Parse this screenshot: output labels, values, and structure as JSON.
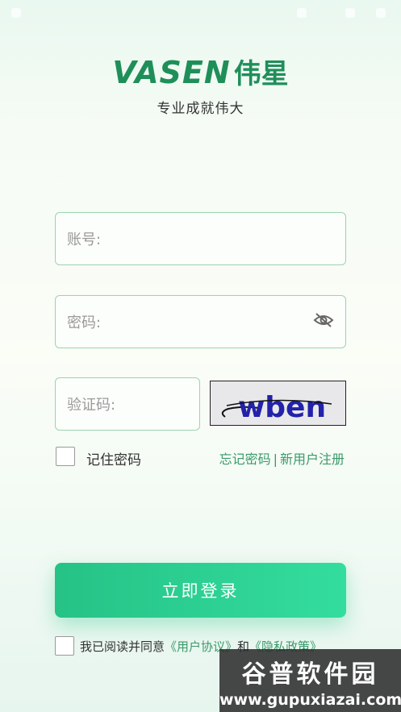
{
  "brand": {
    "logo_en": "VASEN",
    "logo_cn": "伟星",
    "slogan": "专业成就伟大",
    "color": "#1f8f5a"
  },
  "form": {
    "account_placeholder": "账号:",
    "password_placeholder": "密码:",
    "captcha_placeholder": "验证码:",
    "captcha_text": "wben",
    "toggle_visibility_icon": "eye-off-icon"
  },
  "options": {
    "remember_label": "记住密码",
    "forgot_password": "忘记密码",
    "separator": "|",
    "register": "新用户注册"
  },
  "login_button": "立即登录",
  "agreement": {
    "prefix": "我已阅读并同意",
    "user_agreement": "《用户协议》",
    "conjunction": "和",
    "privacy_policy": "《隐私政策》"
  },
  "watermark": {
    "title": "谷普软件园",
    "url": "www.gupuxiazai.com"
  },
  "colors": {
    "accent": "#2ed295",
    "link": "#3a9a6a",
    "border": "#9bd3b2"
  }
}
